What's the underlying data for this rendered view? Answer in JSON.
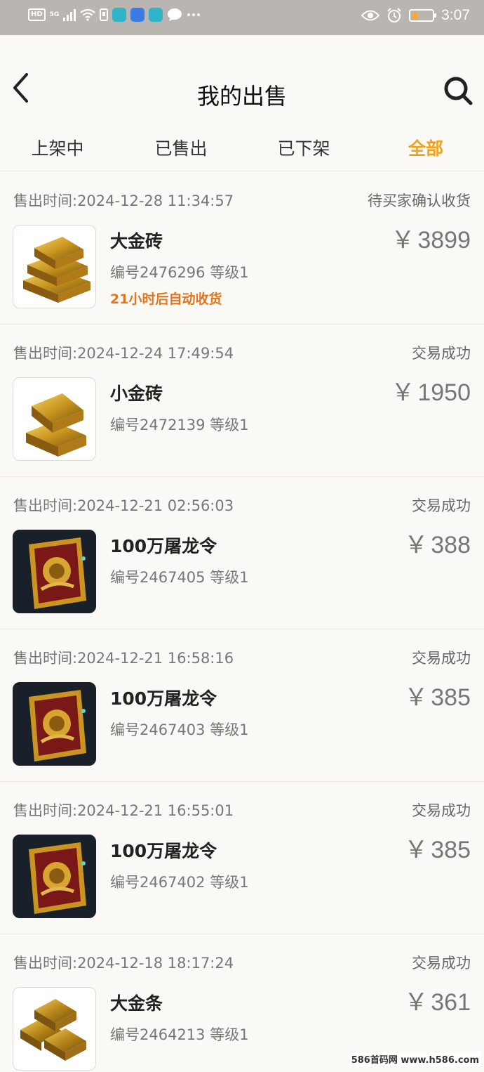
{
  "status_bar": {
    "hd_label": "HD",
    "network_label": "5G",
    "time": "3:07"
  },
  "header": {
    "title": "我的出售",
    "back_icon": "chevron-left-icon",
    "search_icon": "search-icon"
  },
  "tabs": [
    {
      "label": "上架中",
      "active": false
    },
    {
      "label": "已售出",
      "active": false
    },
    {
      "label": "已下架",
      "active": false
    },
    {
      "label": "全部",
      "active": true
    }
  ],
  "orders": [
    {
      "time": "售出时间:2024-12-28 11:34:57",
      "status": "待买家确认收货",
      "name": "大金砖",
      "meta": "编号2476296 等级1",
      "note": "21小时后自动收货",
      "currency": "￥",
      "price": "3899",
      "image": "gold-brick-large-icon"
    },
    {
      "time": "售出时间:2024-12-24 17:49:54",
      "status": "交易成功",
      "name": "小金砖",
      "meta": "编号2472139 等级1",
      "currency": "￥",
      "price": "1950",
      "image": "gold-brick-small-icon"
    },
    {
      "time": "售出时间:2024-12-21 02:56:03",
      "status": "交易成功",
      "name": "100万屠龙令",
      "meta": "编号2467405 等级1",
      "currency": "￥",
      "price": "388",
      "image": "dragon-token-icon"
    },
    {
      "time": "售出时间:2024-12-21 16:58:16",
      "status": "交易成功",
      "name": "100万屠龙令",
      "meta": "编号2467403 等级1",
      "currency": "￥",
      "price": "385",
      "image": "dragon-token-icon"
    },
    {
      "time": "售出时间:2024-12-21 16:55:01",
      "status": "交易成功",
      "name": "100万屠龙令",
      "meta": "编号2467402 等级1",
      "currency": "￥",
      "price": "385",
      "image": "dragon-token-icon"
    },
    {
      "time": "售出时间:2024-12-18 18:17:24",
      "status": "交易成功",
      "name": "大金条",
      "meta": "编号2464213 等级1",
      "currency": "￥",
      "price": "361",
      "image": "gold-bar-icon"
    }
  ],
  "watermark": "586首码网 www.h586.com",
  "colors": {
    "accent": "#f0a21e",
    "note": "#e0771f",
    "status_bar": "#b9b6b2"
  }
}
